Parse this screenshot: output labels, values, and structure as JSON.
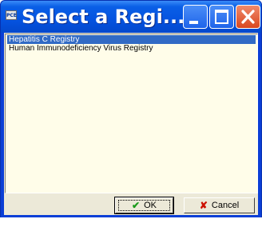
{
  "window": {
    "title": "Select a Regi...",
    "app_icon_text": "PCE"
  },
  "list": {
    "items": [
      {
        "label": "Hepatitis C Registry",
        "selected": true
      },
      {
        "label": "Human Immunodeficiency Virus Registry",
        "selected": false
      }
    ]
  },
  "buttons": {
    "ok_label": "OK",
    "cancel_label": "Cancel"
  },
  "colors": {
    "title_bar": "#0553e0",
    "selection": "#316ac5",
    "list_background": "#fffde9",
    "dialog_background": "#ece9d8"
  },
  "icons": {
    "ok": "checkmark-icon",
    "cancel": "x-icon"
  }
}
